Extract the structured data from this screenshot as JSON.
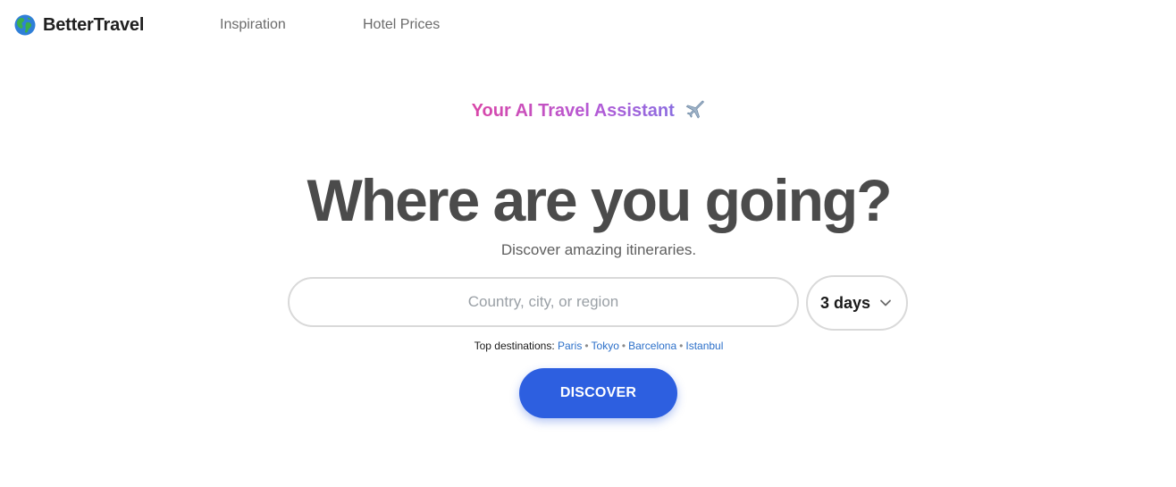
{
  "header": {
    "brand_name": "BetterTravel",
    "brand_icon": "globe-icon",
    "nav": [
      {
        "label": "Inspiration"
      },
      {
        "label": "Hotel Prices"
      }
    ]
  },
  "hero": {
    "tagline": "Your AI Travel Assistant",
    "tagline_icon": "airplane-icon",
    "headline": "Where are you going?",
    "subtitle": "Discover amazing itineraries."
  },
  "search": {
    "placeholder": "Country, city, or region",
    "value": "",
    "duration": {
      "selected": "3 days",
      "icon": "chevron-down-icon"
    }
  },
  "top_destinations": {
    "label": "Top destinations:",
    "items": [
      "Paris",
      "Tokyo",
      "Barcelona",
      "Istanbul"
    ],
    "separator": "•"
  },
  "discover_button": {
    "label": "DISCOVER"
  },
  "colors": {
    "accent": "#2d5fe0",
    "link": "#2b6fc9",
    "tagline_gradient_start": "#d946a8",
    "tagline_gradient_end": "#8b6ee0",
    "headline": "#4b4b4b"
  }
}
